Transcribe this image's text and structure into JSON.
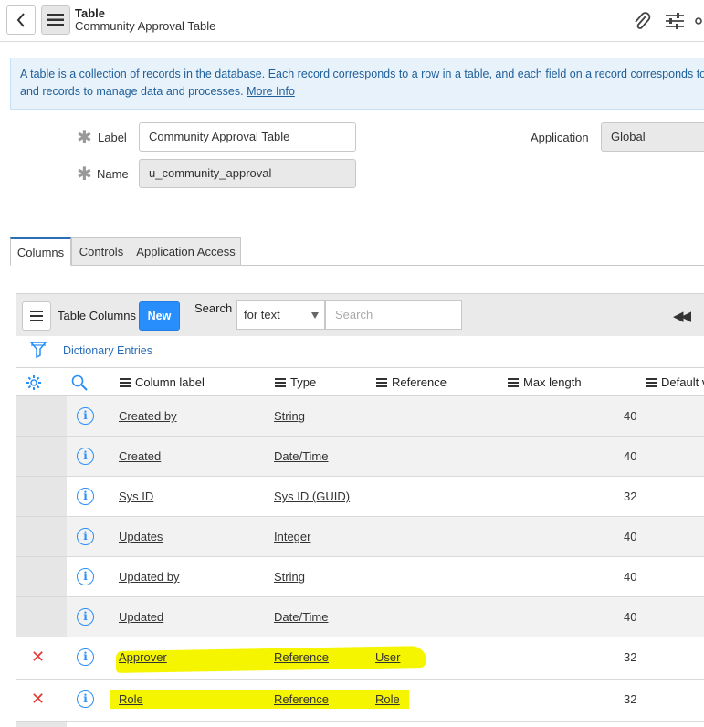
{
  "header": {
    "title": "Table",
    "subtitle": "Community Approval Table",
    "icons": [
      "back-icon",
      "hamburger-icon",
      "paperclip-icon",
      "sliders-icon",
      "more-icon"
    ]
  },
  "info_banner": {
    "line1": "A table is a collection of records in the database. Each record corresponds to a row in a table, and each field on a record corresponds to a co",
    "line2": "and records to manage data and processes.",
    "link": "More Info"
  },
  "form": {
    "label_label": "Label",
    "label_value": "Community Approval Table",
    "name_label": "Name",
    "name_value": "u_community_approval",
    "application_label": "Application",
    "application_value": "Global"
  },
  "tabs": [
    {
      "label": "Columns",
      "active": true
    },
    {
      "label": "Controls",
      "active": false
    },
    {
      "label": "Application Access",
      "active": false
    }
  ],
  "related_list": {
    "title": "Table Columns",
    "new_label": "New",
    "search_label": "Search",
    "search_select": "for text",
    "search_placeholder": "Search",
    "filter_link": "Dictionary Entries",
    "columns": [
      "Column label",
      "Type",
      "Reference",
      "Max length",
      "Default v"
    ],
    "rows": [
      {
        "label": "Created by",
        "type": "String",
        "reference": "",
        "max_length": "40",
        "deletable": false
      },
      {
        "label": "Created",
        "type": "Date/Time",
        "reference": "",
        "max_length": "40",
        "deletable": false
      },
      {
        "label": "Sys ID",
        "type": "Sys ID (GUID)",
        "reference": "",
        "max_length": "32",
        "deletable": false
      },
      {
        "label": "Updates",
        "type": "Integer",
        "reference": "",
        "max_length": "40",
        "deletable": false
      },
      {
        "label": "Updated by",
        "type": "String",
        "reference": "",
        "max_length": "40",
        "deletable": false
      },
      {
        "label": "Updated",
        "type": "Date/Time",
        "reference": "",
        "max_length": "40",
        "deletable": false
      },
      {
        "label": "Approver",
        "type": "Reference",
        "reference": "User",
        "max_length": "32",
        "deletable": true
      },
      {
        "label": "Role",
        "type": "Reference",
        "reference": "Role",
        "max_length": "32",
        "deletable": true
      }
    ]
  },
  "colors": {
    "accent": "#278efc",
    "delete": "#e53935",
    "highlight": "#f5f500",
    "info_bg": "#e8f2fb"
  }
}
